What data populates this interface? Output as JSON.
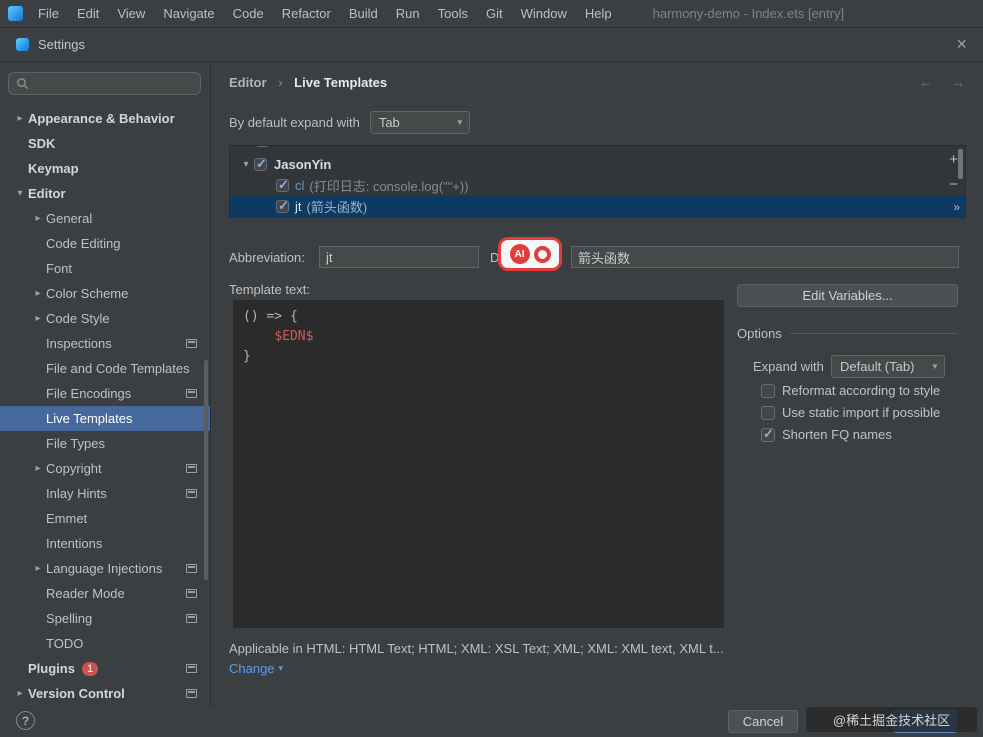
{
  "menu_bar": {
    "items": [
      "File",
      "Edit",
      "View",
      "Navigate",
      "Code",
      "Refactor",
      "Build",
      "Run",
      "Tools",
      "Git",
      "Window",
      "Help"
    ],
    "window_title": "harmony-demo - Index.ets [entry]"
  },
  "dialog": {
    "title": "Settings"
  },
  "icons": {
    "close": "×",
    "back": "←",
    "forward": "→",
    "dropdown_arrow": "▼",
    "collapsed": "▸",
    "expanded": "▾",
    "check": "✓",
    "change_caret": "▾",
    "help": "?"
  },
  "sidebar": {
    "search_placeholder": "",
    "items": [
      {
        "label": "Appearance & Behavior",
        "level": 0,
        "bold": true,
        "chevron": "right"
      },
      {
        "label": "SDK",
        "level": 0,
        "bold": true
      },
      {
        "label": "Keymap",
        "level": 0,
        "bold": true
      },
      {
        "label": "Editor",
        "level": 0,
        "bold": true,
        "chevron": "down"
      },
      {
        "label": "General",
        "level": 1,
        "chevron": "right"
      },
      {
        "label": "Code Editing",
        "level": 1
      },
      {
        "label": "Font",
        "level": 1
      },
      {
        "label": "Color Scheme",
        "level": 1,
        "chevron": "right"
      },
      {
        "label": "Code Style",
        "level": 1,
        "chevron": "right"
      },
      {
        "label": "Inspections",
        "level": 1,
        "panel_icon": true
      },
      {
        "label": "File and Code Templates",
        "level": 1
      },
      {
        "label": "File Encodings",
        "level": 1,
        "panel_icon": true
      },
      {
        "label": "Live Templates",
        "level": 1,
        "selected": true
      },
      {
        "label": "File Types",
        "level": 1
      },
      {
        "label": "Copyright",
        "level": 1,
        "chevron": "right",
        "panel_icon": true
      },
      {
        "label": "Inlay Hints",
        "level": 1,
        "panel_icon": true
      },
      {
        "label": "Emmet",
        "level": 1
      },
      {
        "label": "Intentions",
        "level": 1
      },
      {
        "label": "Language Injections",
        "level": 1,
        "chevron": "right",
        "panel_icon": true
      },
      {
        "label": "Reader Mode",
        "level": 1,
        "panel_icon": true
      },
      {
        "label": "Spelling",
        "level": 1,
        "panel_icon": true
      },
      {
        "label": "TODO",
        "level": 1
      },
      {
        "label": "Plugins",
        "level": 0,
        "bold": true,
        "badge": "1",
        "panel_icon": true
      },
      {
        "label": "Version Control",
        "level": 0,
        "bold": true,
        "chevron": "right",
        "panel_icon": true
      }
    ]
  },
  "breadcrumb": {
    "parent": "Editor",
    "separator": "›",
    "current": "Live Templates"
  },
  "expand_default": {
    "label": "By default expand with",
    "value": "Tab"
  },
  "template_list": {
    "group": {
      "label": "JasonYin",
      "checked": true
    },
    "items": [
      {
        "abbr": "cl",
        "desc": "(打印日志: console.log(\"\"+))",
        "checked": true,
        "selected": false
      },
      {
        "abbr": "jt",
        "desc": "(箭头函数)",
        "checked": true,
        "selected": true
      }
    ],
    "toolbar_icons": [
      "+",
      "−",
      "»"
    ]
  },
  "editor_panel": {
    "abbreviation_label": "Abbreviation:",
    "abbreviation_value": "jt",
    "description_label": "Description:",
    "description_value": "箭头函数",
    "ai_badge_text": "AI",
    "template_text_label": "Template text:",
    "code_lines": [
      "() => {",
      "    $EDN$",
      "}"
    ],
    "edit_variables_label": "Edit Variables...",
    "options_title": "Options",
    "expand_with_label": "Expand with",
    "expand_with_value": "Default (Tab)",
    "checkboxes": [
      {
        "label": "Reformat according to style",
        "checked": false
      },
      {
        "label": "Use static import if possible",
        "checked": false
      },
      {
        "label": "Shorten FQ names",
        "checked": true
      }
    ],
    "applicable_text": "Applicable in HTML: HTML Text; HTML; XML: XSL Text; XML; XML: XML text, XML t...",
    "change_label": "Change"
  },
  "footer": {
    "cancel_label": "Cancel",
    "ok_label": "OK",
    "watermark": "@稀土掘金技术社区"
  },
  "colors": {
    "sidebar_selection": "#45699c",
    "list_selection": "#0d3a63",
    "link_blue": "#5a9ff0",
    "badge_red": "#e23c3c",
    "ok_button_blue": "#3c6eb5",
    "template_variable_red": "#cf5b56"
  }
}
